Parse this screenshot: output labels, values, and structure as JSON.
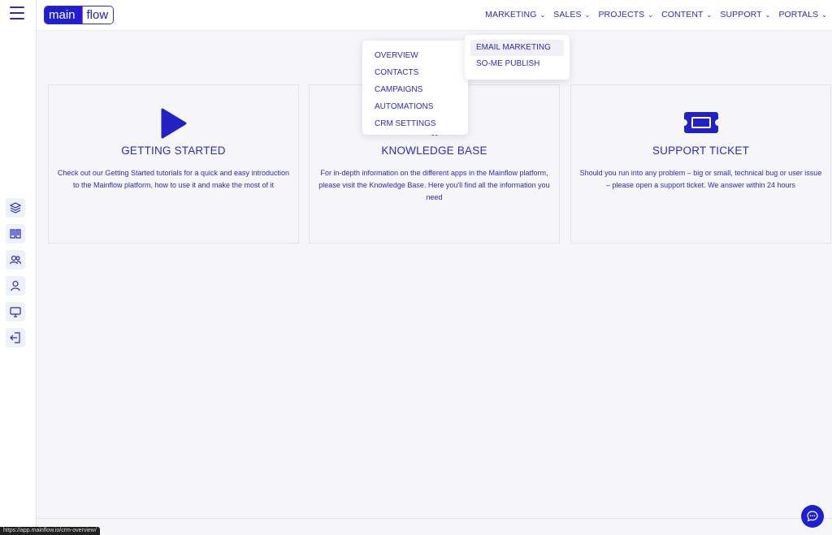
{
  "logo": {
    "part1": "main",
    "part2": "flow"
  },
  "nav": {
    "items": [
      {
        "label": "MARKETING"
      },
      {
        "label": "SALES"
      },
      {
        "label": "PROJECTS"
      },
      {
        "label": "CONTENT"
      },
      {
        "label": "SUPPORT"
      },
      {
        "label": "PORTALS"
      }
    ]
  },
  "crm_menu": {
    "items": [
      {
        "label": "OVERVIEW"
      },
      {
        "label": "CONTACTS"
      },
      {
        "label": "CAMPAIGNS"
      },
      {
        "label": "AUTOMATIONS"
      },
      {
        "label": "CRM SETTINGS"
      }
    ]
  },
  "marketing_menu": {
    "items": [
      {
        "label": "EMAIL MARKETING",
        "highlighted": true
      },
      {
        "label": "SO-ME PUBLISH"
      }
    ]
  },
  "cards": [
    {
      "icon": "play-icon",
      "title": "GETTING STARTED",
      "text": "Check out our Getting Started tutorials for a quick and easy introduction to the Mainflow platform, how to use it and make the most of it"
    },
    {
      "icon": "book-icon",
      "title": "KNOWLEDGE BASE",
      "text": "For in-depth information on the different apps in the Mainflow platform, please visit the Knowledge Base. Here you'll find all the information you need"
    },
    {
      "icon": "ticket-icon",
      "title": "SUPPORT TICKET",
      "text": "Should you run into any problem – big or small, technical bug or user issue – please open a support ticket. We answer within 24 hours"
    }
  ],
  "rail_icons": [
    "layers-icon",
    "book-open-icon",
    "users-icon",
    "user-icon",
    "monitor-icon",
    "logout-icon"
  ],
  "status_bar": {
    "url": "https://app.mainflow.io/crm-overview/"
  },
  "colors": {
    "accent": "#1f1fd1",
    "text": "#2b2bc0",
    "background": "#f6f6f9"
  }
}
